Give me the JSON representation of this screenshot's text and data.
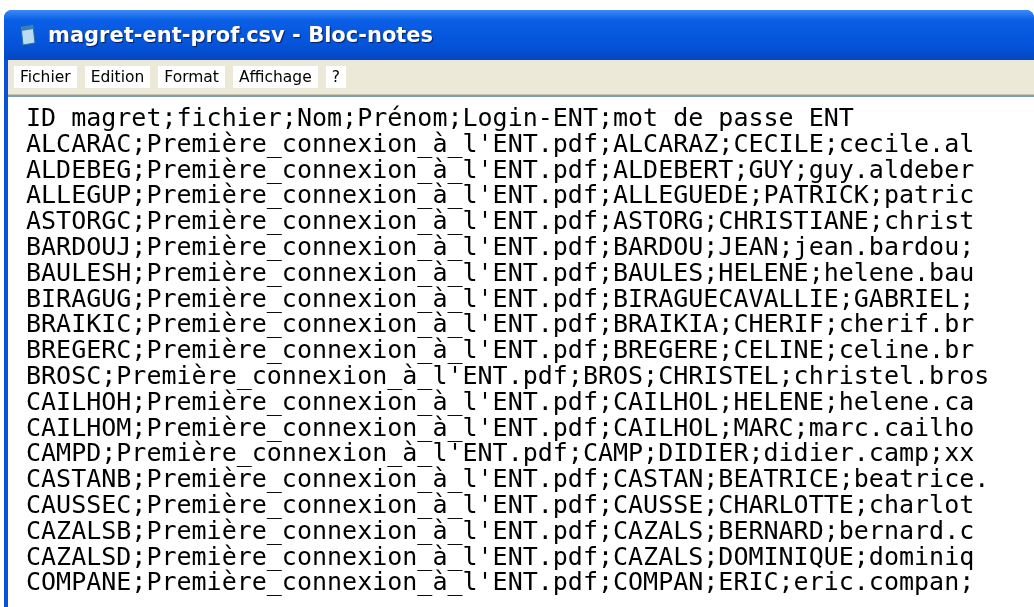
{
  "window": {
    "title": "magret-ent-prof.csv - Bloc-notes"
  },
  "menu": [
    "Fichier",
    "Edition",
    "Format",
    "Affichage",
    "?"
  ],
  "lines": [
    "ID magret;fichier;Nom;Prénom;Login-ENT;mot de passe ENT",
    "ALCARAC;Première_connexion_à_l'ENT.pdf;ALCARAZ;CECILE;cecile.al",
    "ALDEBEG;Première_connexion_à_l'ENT.pdf;ALDEBERT;GUY;guy.aldeber",
    "ALLEGUP;Première_connexion_à_l'ENT.pdf;ALLEGUEDE;PATRICK;patric",
    "ASTORGC;Première_connexion_à_l'ENT.pdf;ASTORG;CHRISTIANE;christ",
    "BARDOUJ;Première_connexion_à_l'ENT.pdf;BARDOU;JEAN;jean.bardou;",
    "BAULESH;Première_connexion_à_l'ENT.pdf;BAULES;HELENE;helene.bau",
    "BIRAGUG;Première_connexion_à_l'ENT.pdf;BIRAGUECAVALLIE;GABRIEL;",
    "BRAIKIC;Première_connexion_à_l'ENT.pdf;BRAIKIA;CHERIF;cherif.br",
    "BREGERC;Première_connexion_à_l'ENT.pdf;BREGERE;CELINE;celine.br",
    "BROSC;Première_connexion_à_l'ENT.pdf;BROS;CHRISTEL;christel.bros",
    "CAILHOH;Première_connexion_à_l'ENT.pdf;CAILHOL;HELENE;helene.ca",
    "CAILHOM;Première_connexion_à_l'ENT.pdf;CAILHOL;MARC;marc.cailho",
    "CAMPD;Première_connexion_à_l'ENT.pdf;CAMP;DIDIER;didier.camp;xx",
    "CASTANB;Première_connexion_à_l'ENT.pdf;CASTAN;BEATRICE;beatrice.",
    "CAUSSEC;Première_connexion_à_l'ENT.pdf;CAUSSE;CHARLOTTE;charlot",
    "CAZALSB;Première_connexion_à_l'ENT.pdf;CAZALS;BERNARD;bernard.c",
    "CAZALSD;Première_connexion_à_l'ENT.pdf;CAZALS;DOMINIQUE;dominiq",
    "COMPANE;Première_connexion_à_l'ENT.pdf;COMPAN;ERIC;eric.compan;"
  ]
}
